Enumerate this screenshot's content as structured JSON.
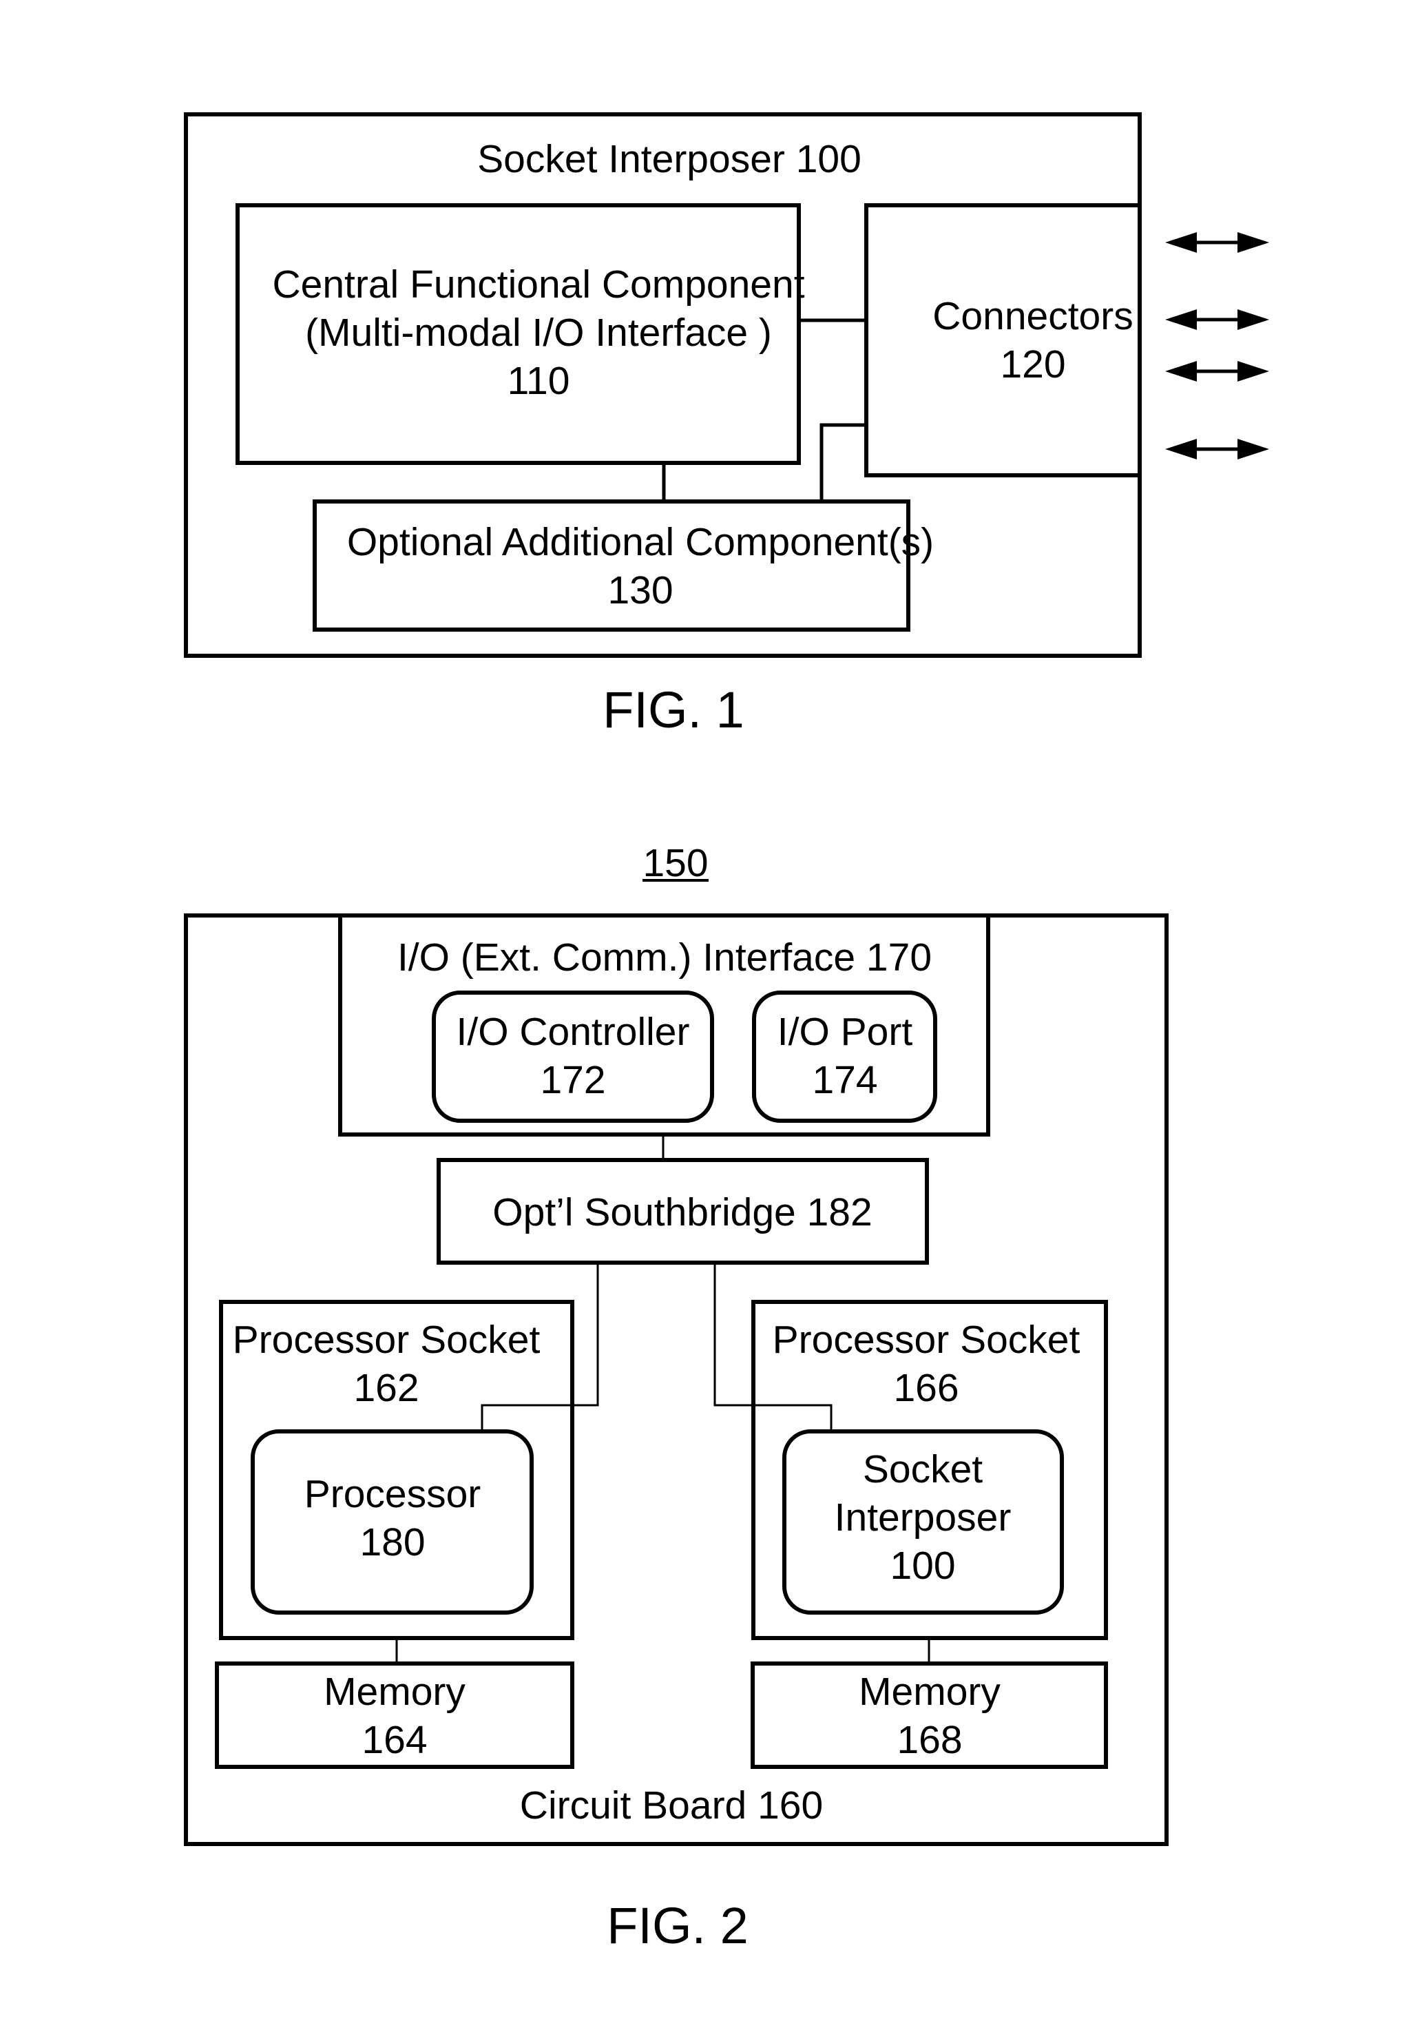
{
  "figure1": {
    "caption": "FIG. 1",
    "socket_interposer": {
      "title": "Socket Interposer 100"
    },
    "central_functional_component": {
      "lines": [
        "Central Functional Component",
        "(Multi-modal I/O Interface )",
        "110"
      ]
    },
    "connectors": {
      "lines": [
        "Connectors",
        "120"
      ]
    },
    "optional_components": {
      "lines": [
        "Optional Additional Component(s)",
        "130"
      ]
    },
    "external_arrows": {
      "count": 4,
      "direction": "bidirectional"
    }
  },
  "figure2": {
    "caption": "FIG. 2",
    "reference_label": "150",
    "circuit_board": {
      "title": "Circuit Board 160"
    },
    "io_interface": {
      "title": "I/O (Ext. Comm.) Interface 170"
    },
    "io_controller": {
      "lines": [
        "I/O Controller",
        "172"
      ]
    },
    "io_port": {
      "lines": [
        "I/O Port",
        "174"
      ]
    },
    "southbridge": {
      "title": "Opt’l Southbridge 182"
    },
    "processor_socket_left": {
      "lines": [
        "Processor Socket",
        "162"
      ]
    },
    "processor": {
      "lines": [
        "Processor",
        "180"
      ]
    },
    "processor_socket_right": {
      "lines": [
        "Processor Socket",
        "166"
      ]
    },
    "socket_interposer": {
      "lines": [
        "Socket",
        "Interposer",
        "100"
      ]
    },
    "memory_left": {
      "lines": [
        "Memory",
        "164"
      ]
    },
    "memory_right": {
      "lines": [
        "Memory",
        "168"
      ]
    }
  }
}
